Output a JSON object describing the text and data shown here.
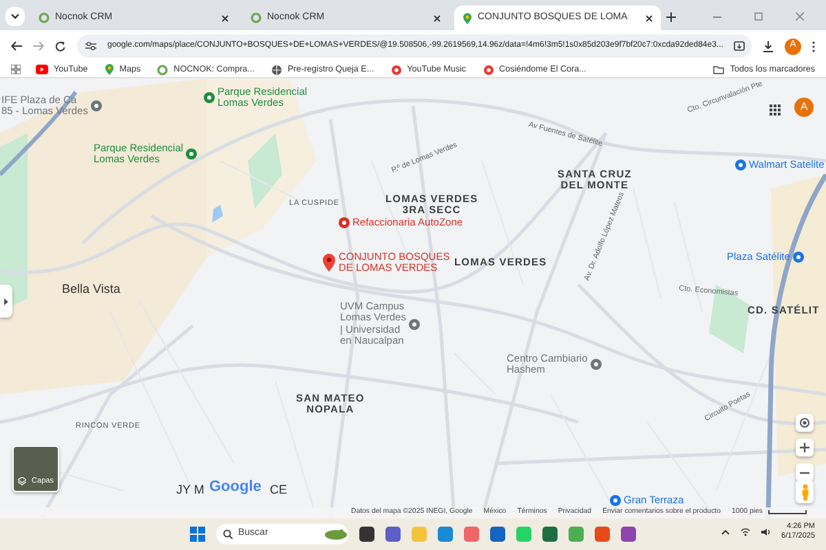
{
  "browser": {
    "tabs": [
      {
        "title": "Nocnok CRM",
        "selected": false
      },
      {
        "title": "Nocnok CRM",
        "selected": false
      },
      {
        "title": "CONJUNTO BOSQUES DE LOMA",
        "selected": true
      }
    ],
    "url": "google.com/maps/place/CONJUNTO+BOSQUES+DE+LOMAS+VERDES/@19.508506,-99.2619569,14.96z/data=!4m6!3m5!1s0x85d203e9f7bf20c7:0xcda92ded84e3...",
    "profile_initial": "A",
    "bookmarks": [
      {
        "label": "YouTube"
      },
      {
        "label": "Maps"
      },
      {
        "label": "NOCNOK: Compra..."
      },
      {
        "label": "Pre-registro Queja E..."
      },
      {
        "label": "YouTube Music"
      },
      {
        "label": "Cosiéndome El Cora..."
      }
    ],
    "all_bookmarks": "Todos los marcadores"
  },
  "map": {
    "labels": [
      {
        "kind": "poi",
        "text": "Parque Residencial\nLomas Verdes",
        "color": "#1e8e3e"
      },
      {
        "kind": "poi",
        "text": "Parque Residencial\nLomas Verdes",
        "color": "#1e8e3e"
      },
      {
        "kind": "poi",
        "text": "IFE Plaza de Ca\n85 - Lomas Verdes",
        "color": "#70757a"
      },
      {
        "kind": "neighborhood",
        "text": "LA CUSPIDE"
      },
      {
        "kind": "district",
        "text": "LOMAS VERDES\n3RA SECC"
      },
      {
        "kind": "poi",
        "text": "Refaccionaria AutoZone",
        "color": "#d93025"
      },
      {
        "kind": "pin",
        "text": "CONJUNTO BOSQUES\nDE LOMAS VERDES"
      },
      {
        "kind": "place",
        "text": "Bella Vista"
      },
      {
        "kind": "district",
        "text": "LOMAS VERDES"
      },
      {
        "kind": "district",
        "text": "SANTA CRUZ\nDEL MONTE"
      },
      {
        "kind": "poi",
        "text": "Walmart Satelite",
        "color": "#1a73e8"
      },
      {
        "kind": "poi",
        "text": "Plaza Satélite",
        "color": "#1a73e8"
      },
      {
        "kind": "poi",
        "text": "UVM Campus\nLomas Verdes\n| Universidad\nen Naucalpan",
        "color": "#70757a"
      },
      {
        "kind": "district",
        "text": "CD. SATÉLIT"
      },
      {
        "kind": "poi",
        "text": "Centro Cambiario\nHashem",
        "color": "#70757a"
      },
      {
        "kind": "district",
        "text": "SAN MATEO\nNOPALA"
      },
      {
        "kind": "neighborhood",
        "text": "RINCON VERDE"
      },
      {
        "kind": "poi",
        "text": "Gran Terraza",
        "color": "#1a73e8"
      },
      {
        "kind": "place",
        "text": "JY M"
      },
      {
        "kind": "place",
        "text": "CE"
      },
      {
        "kind": "street",
        "text": "Av Fuentes de Satélite"
      },
      {
        "kind": "street",
        "text": "Cto. Circunvalación Pte"
      },
      {
        "kind": "street",
        "text": "Av. Dr. Adolfo López Mateos"
      },
      {
        "kind": "street",
        "text": "Cto. Economistas"
      },
      {
        "kind": "street",
        "text": "Circuito Poetas"
      },
      {
        "kind": "street",
        "text": "P.º de Lomas Verdes"
      }
    ],
    "logo": "Google",
    "profile_initial": "A",
    "layers_label": "Capas",
    "attribution": [
      "Datos del mapa ©2025 INEGI, Google",
      "México",
      "Términos",
      "Privacidad",
      "Enviar comentarios sobre el producto"
    ],
    "scale": "1000 pies"
  },
  "taskbar": {
    "search_placeholder": "Buscar",
    "time": "4:26 PM",
    "date": "6/17/2025"
  }
}
